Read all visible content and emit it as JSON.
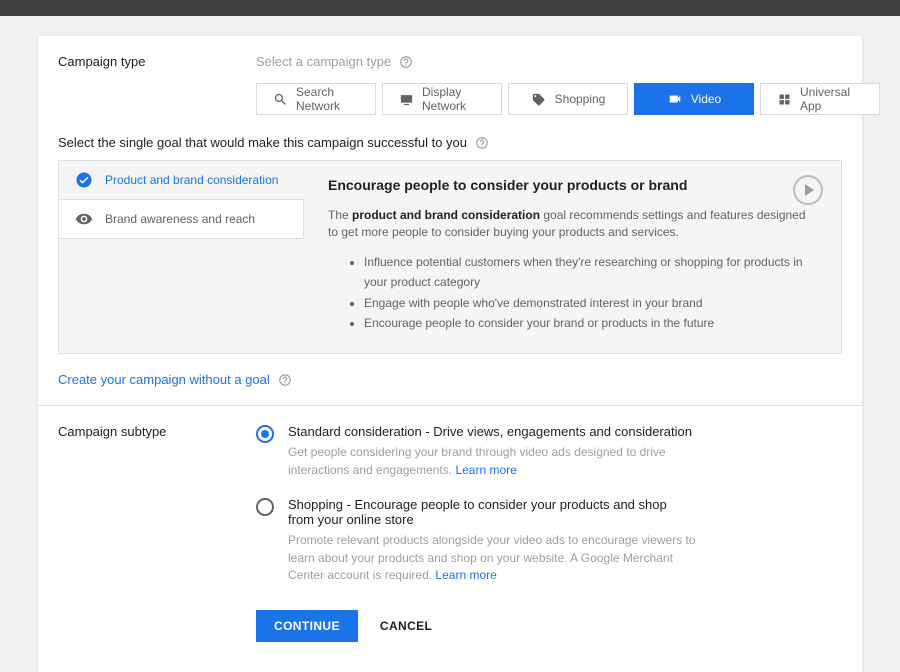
{
  "campaign_type": {
    "label": "Campaign type",
    "hint": "Select a campaign type",
    "tabs": [
      {
        "label": "Search Network"
      },
      {
        "label": "Display Network"
      },
      {
        "label": "Shopping"
      },
      {
        "label": "Video"
      },
      {
        "label": "Universal App"
      }
    ]
  },
  "goal": {
    "instruction": "Select the single goal that would make this campaign successful to you",
    "items": [
      {
        "label": "Product and brand consideration"
      },
      {
        "label": "Brand awareness and reach"
      }
    ],
    "detail": {
      "heading": "Encourage people to consider your products or brand",
      "lead_before": "The ",
      "lead_strong": "product and brand consideration",
      "lead_after": " goal recommends settings and features designed to get more people to consider buying your products and services.",
      "bullets": [
        "Influence potential customers when they're researching or shopping for products in your product category",
        "Engage with people who've demonstrated interest in your brand",
        "Encourage people to consider your brand or products in the future"
      ]
    },
    "no_goal_link": "Create your campaign without a goal"
  },
  "subtype": {
    "label": "Campaign subtype",
    "options": [
      {
        "title": "Standard consideration - Drive views, engagements and consideration",
        "desc": "Get people considering your brand through video ads designed to drive interactions and engagements.",
        "learn": "Learn more"
      },
      {
        "title": "Shopping - Encourage people to consider your products and shop from your online store",
        "desc": "Promote relevant products alongside your video ads to encourage viewers to learn about your products and shop on your website. A Google Merchant Center account is required.",
        "learn": "Learn more"
      }
    ]
  },
  "actions": {
    "continue": "CONTINUE",
    "cancel": "CANCEL"
  }
}
